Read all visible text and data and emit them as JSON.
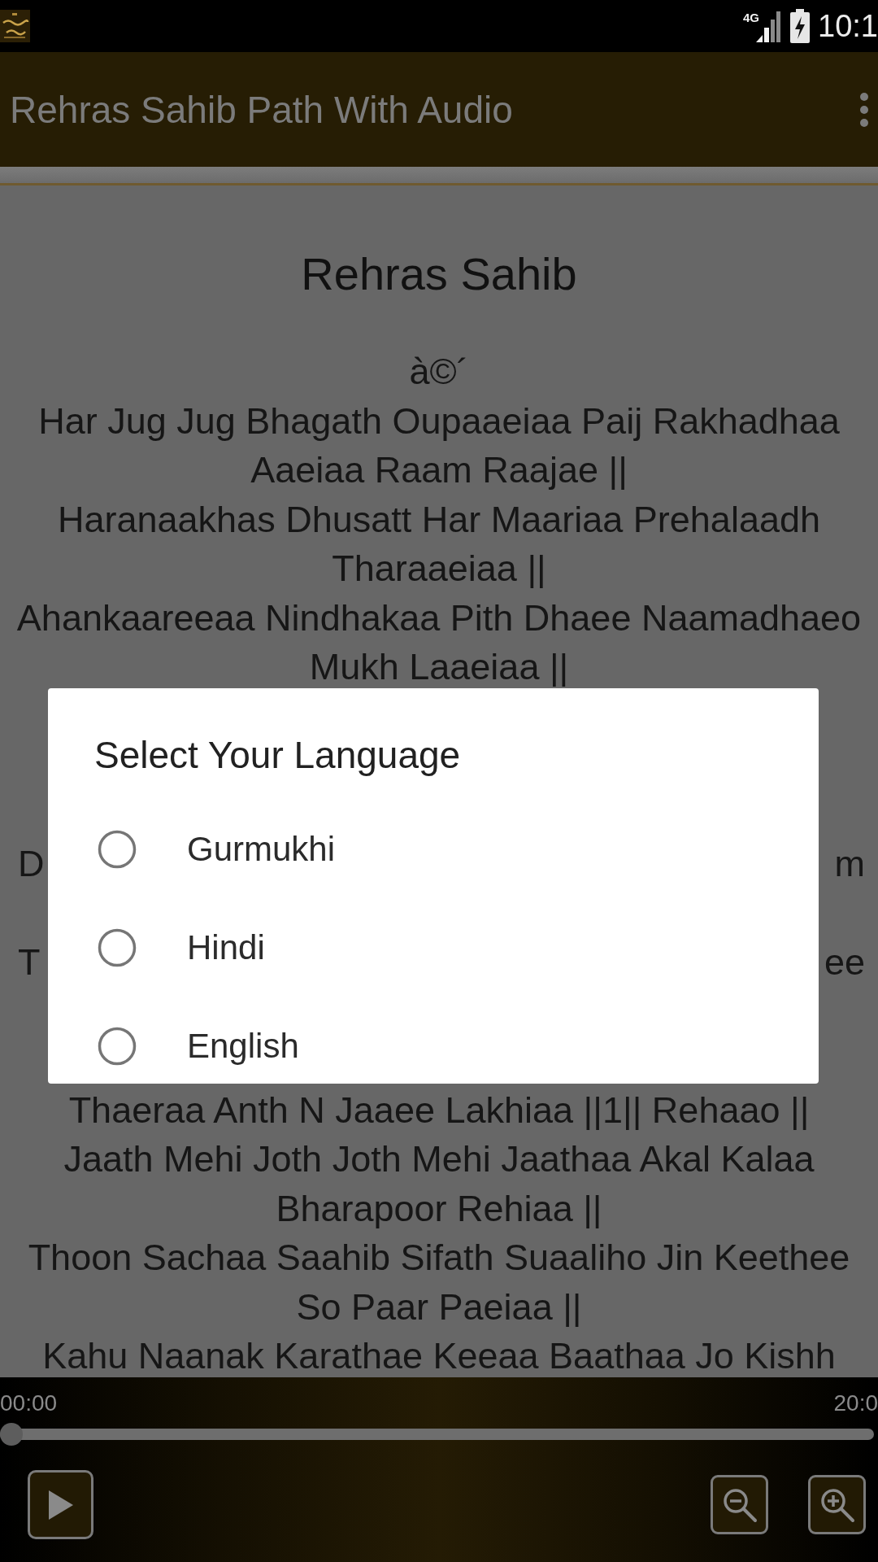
{
  "status_bar": {
    "network": "4G",
    "clock": "10:1"
  },
  "app_bar": {
    "title": "Rehras Sahib Path With Audio"
  },
  "content": {
    "heading": "Rehras Sahib",
    "lines_above": [
      "à©´",
      "Har Jug Jug Bhagath Oupaaeiaa Paij Rakhadhaa Aaeiaa Raam Raajae ||",
      "Haranaakhas Dhusatt Har Maariaa Prehalaadh Tharaaeiaa ||",
      "Ahankaareeaa Nindhakaa Pith Dhaee Naamadhaeo Mukh Laaeiaa ||"
    ],
    "covered_lines": [
      {
        "left": "D",
        "right": "m"
      },
      {
        "left": "T",
        "right": "ee"
      }
    ],
    "lines_below": [
      "Thaeraa Anth N Jaaee Lakhiaa ||1|| Rehaao ||",
      "Jaath Mehi Joth Joth Mehi Jaathaa Akal Kalaa Bharapoor Rehiaa ||",
      "Thoon Sachaa Saahib Sifath Suaaliho Jin Keethee So Paar Paeiaa ||",
      "Kahu Naanak Karathae Keeaa Baathaa Jo Kishh"
    ]
  },
  "dialog": {
    "title": "Select Your Language",
    "options": [
      {
        "label": "Gurmukhi",
        "selected": false
      },
      {
        "label": "Hindi",
        "selected": false
      },
      {
        "label": "English",
        "selected": false
      }
    ]
  },
  "player": {
    "elapsed": "00:00",
    "total": "20:0",
    "seek": {
      "level": 0
    }
  }
}
